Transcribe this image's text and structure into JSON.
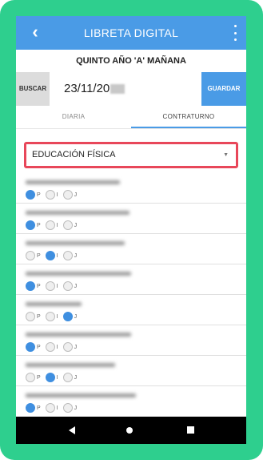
{
  "app": {
    "title": "LIBRETA DIGITAL"
  },
  "course": {
    "label": "QUINTO AÑO 'A' MAÑANA"
  },
  "toolbar": {
    "search_label": "BUSCAR",
    "date": "23/11/20",
    "save_label": "GUARDAR"
  },
  "tabs": [
    {
      "label": "DIARIA",
      "selected": false
    },
    {
      "label": "CONTRATURNO",
      "selected": true
    }
  ],
  "subject": {
    "selected": "EDUCACIÓN FÍSICA"
  },
  "attendance_options": [
    "P",
    "I",
    "J"
  ],
  "students": [
    {
      "selected": "P"
    },
    {
      "selected": "P"
    },
    {
      "selected": "I"
    },
    {
      "selected": "P"
    },
    {
      "selected": "J"
    },
    {
      "selected": "P"
    },
    {
      "selected": "I"
    },
    {
      "selected": "P"
    }
  ],
  "colors": {
    "accent": "#4a9be6",
    "frame": "#2ecf8e",
    "highlight_border": "#e8475a",
    "radio_selected": "#3f8fe0"
  },
  "icons": {
    "back": "arrow-left-icon",
    "menu": "more-vert-icon",
    "dropdown": "caret-down-icon",
    "nav": [
      "nav-back-icon",
      "nav-home-icon",
      "nav-recents-icon"
    ]
  }
}
